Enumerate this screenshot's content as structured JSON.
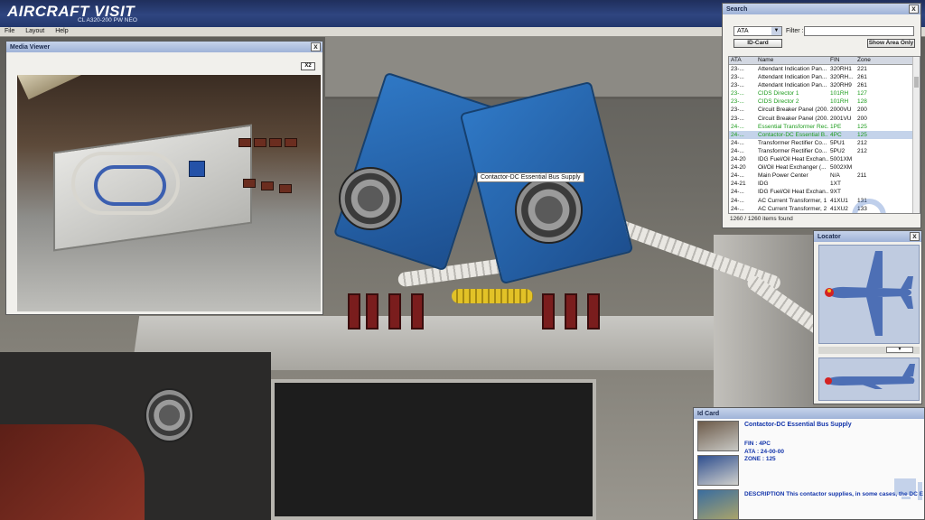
{
  "app": {
    "title": "AIRCRAFT VISIT",
    "subtitle": "CL A320-200 PW NEO"
  },
  "menu": [
    "File",
    "Layout",
    "Help"
  ],
  "scene": {
    "tooltip": "Contactor-DC Essential Bus Supply"
  },
  "media_viewer": {
    "title": "Media Viewer",
    "close": "x",
    "zoom_button": "X2"
  },
  "search": {
    "title": "Search",
    "close": "x",
    "selected_field": "ATA",
    "filter_label": "Filter :",
    "filter_value": "",
    "idcard_button": "ID-Card",
    "show_area_button": "Show Area Only",
    "columns": [
      "ATA",
      "Name",
      "FIN",
      "Zone"
    ],
    "rows": [
      {
        "ata": "23-...",
        "name": "Attendant Indication Pan...",
        "fin": "320RH1",
        "zone": "221",
        "state": "normal"
      },
      {
        "ata": "23-...",
        "name": "Attendant Indication Pan...",
        "fin": "320RH...",
        "zone": "261",
        "state": "normal"
      },
      {
        "ata": "23-...",
        "name": "Attendant Indication Pan...",
        "fin": "320RH9",
        "zone": "261",
        "state": "normal"
      },
      {
        "ata": "23-...",
        "name": "CIDS Director 1",
        "fin": "101RH",
        "zone": "127",
        "state": "green"
      },
      {
        "ata": "23-...",
        "name": "CIDS Director 2",
        "fin": "101RH",
        "zone": "128",
        "state": "green"
      },
      {
        "ata": "23-...",
        "name": "Circuit Breaker Panel (200...",
        "fin": "2000VU",
        "zone": "200",
        "state": "normal"
      },
      {
        "ata": "23-...",
        "name": "Circuit Breaker Panel (200...",
        "fin": "2001VU",
        "zone": "200",
        "state": "normal"
      },
      {
        "ata": "24-...",
        "name": "Essential Transformer Rec...",
        "fin": "1PE",
        "zone": "125",
        "state": "green"
      },
      {
        "ata": "24-...",
        "name": "Contactor-DC Essential B...",
        "fin": "4PC",
        "zone": "125",
        "state": "selected"
      },
      {
        "ata": "24-...",
        "name": "Transformer Rectifier Co...",
        "fin": "5PU1",
        "zone": "212",
        "state": "normal"
      },
      {
        "ata": "24-...",
        "name": "Transformer Rectifier Co...",
        "fin": "5PU2",
        "zone": "212",
        "state": "normal"
      },
      {
        "ata": "24-20",
        "name": "IDG Fuel/Oil Heat Exchan...",
        "fin": "5001XM",
        "zone": "",
        "state": "normal"
      },
      {
        "ata": "24-20",
        "name": "Oil/Oil Heat Exchanger (...",
        "fin": "5002XM",
        "zone": "",
        "state": "normal"
      },
      {
        "ata": "24-...",
        "name": "Main Power Center",
        "fin": "N/A",
        "zone": "211",
        "state": "normal"
      },
      {
        "ata": "24-21",
        "name": "IDG",
        "fin": "1XT",
        "zone": "",
        "state": "normal"
      },
      {
        "ata": "24-...",
        "name": "IDG Fuel/Oil Heat Exchan...",
        "fin": "9XT",
        "zone": "",
        "state": "normal"
      },
      {
        "ata": "24-...",
        "name": "AC Current Transformer, 1",
        "fin": "41XU1",
        "zone": "131",
        "state": "normal"
      },
      {
        "ata": "24-...",
        "name": "AC Current Transformer, 2",
        "fin": "41XU2",
        "zone": "133",
        "state": "normal"
      }
    ],
    "items_found": "1260 / 1260 items found"
  },
  "locator": {
    "title": "Locator",
    "close": "x"
  },
  "idcard": {
    "title": "Id Card",
    "name": "Contactor-DC Essential Bus Supply",
    "fin": "FIN : 4PC",
    "ata": "ATA : 24-00-00",
    "zone": "ZONE : 125",
    "description": "DESCRIPTION This contactor supplies, in some cases, the DC ESS bu"
  },
  "colors": {
    "titlebar": "#2f4580",
    "panel_head": "#9fb3d8",
    "green_text": "#1d9c1d",
    "selected_row": "#c4d3ea",
    "idcard_text": "#1234aa",
    "contactor_blue": "#2f78c5"
  }
}
